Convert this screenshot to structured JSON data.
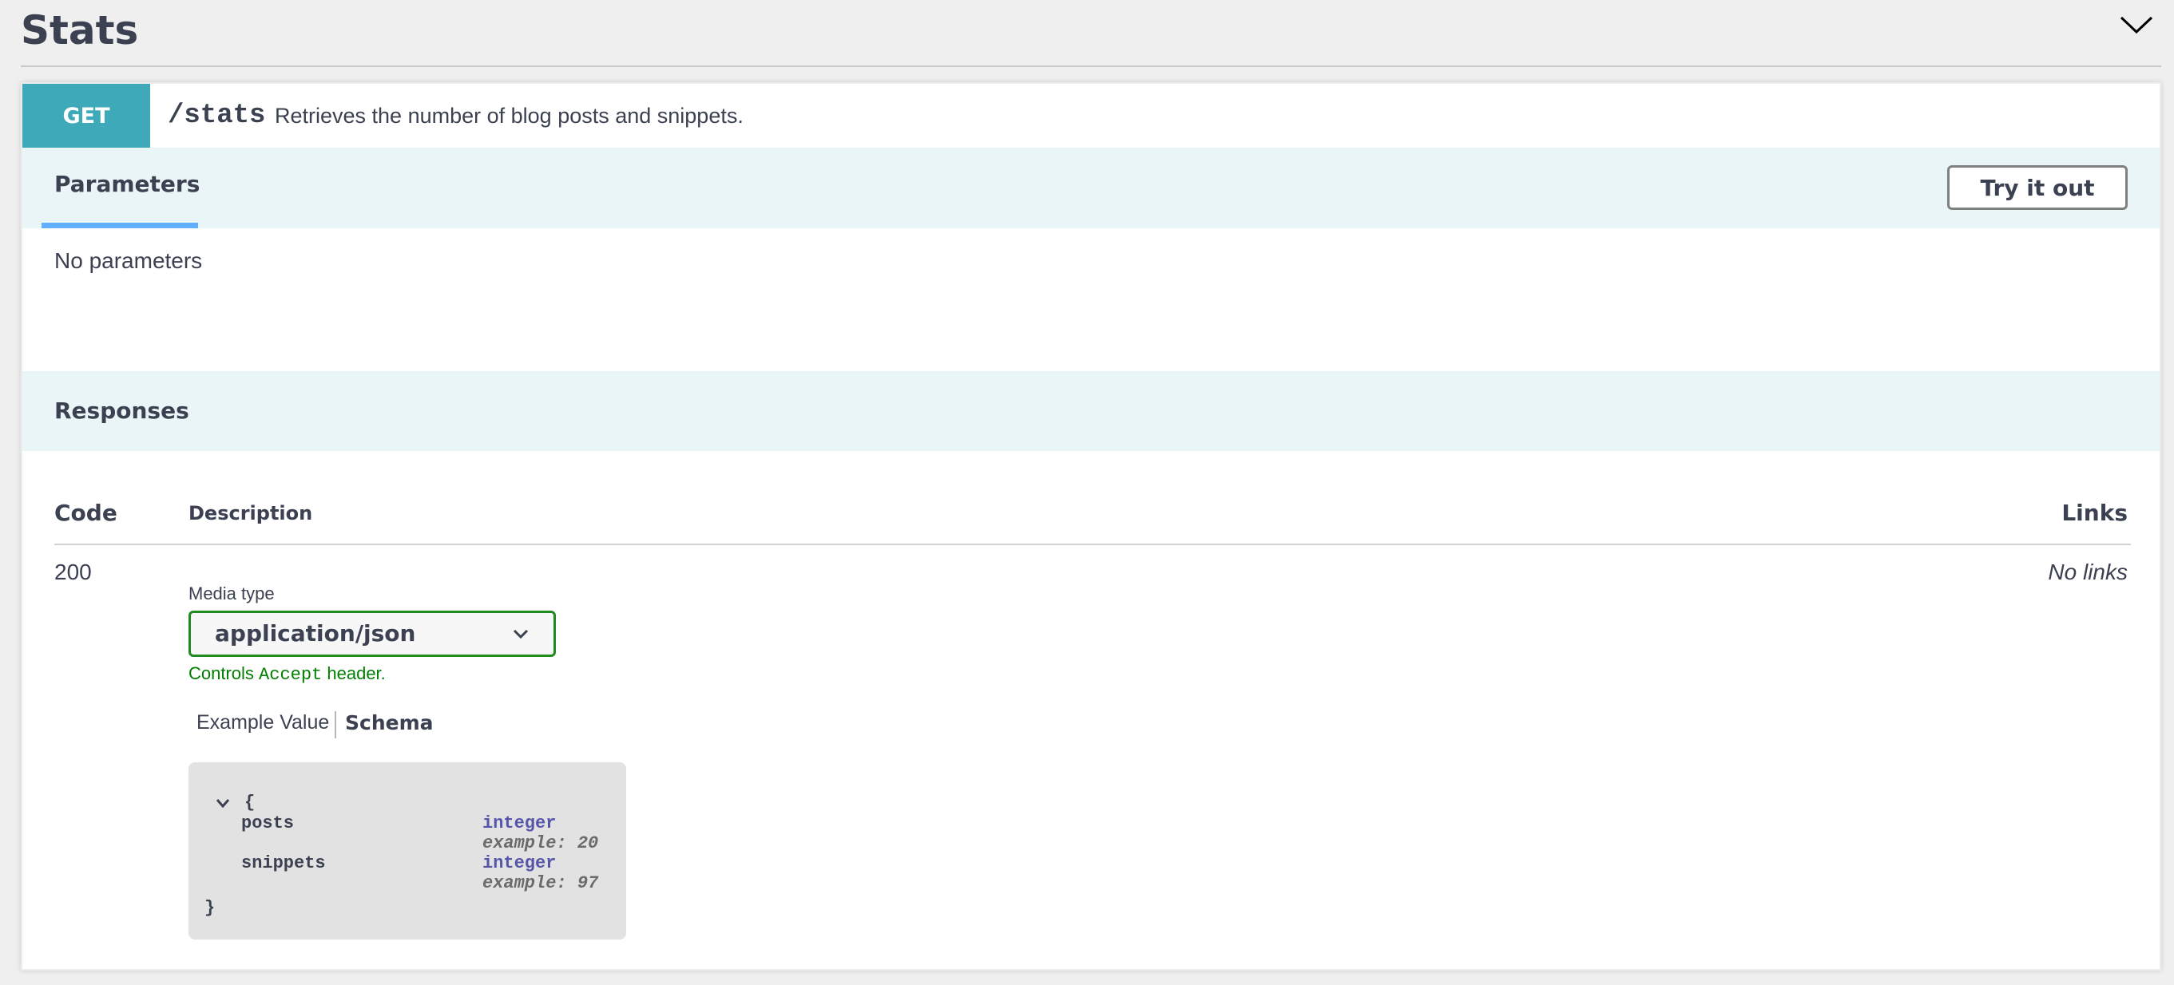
{
  "section": {
    "title": "Stats"
  },
  "operation": {
    "method": "GET",
    "path": "/stats",
    "description": "Retrieves the number of blog posts and snippets."
  },
  "parameters": {
    "tab_label": "Parameters",
    "try_button": "Try it out",
    "empty_text": "No parameters"
  },
  "responses": {
    "title": "Responses",
    "columns": {
      "code": "Code",
      "description": "Description",
      "links": "Links"
    },
    "rows": [
      {
        "code": "200",
        "links": "No links",
        "media_type_label": "Media type",
        "media_type_value": "application/json",
        "controls_prefix": "Controls ",
        "controls_code": "Accept",
        "controls_suffix": " header.",
        "tabs": [
          "Example Value",
          "Schema"
        ],
        "active_tab": "Schema",
        "schema": {
          "open": "{",
          "close": "}",
          "properties": [
            {
              "name": "posts",
              "type": "integer",
              "example": "example: 20"
            },
            {
              "name": "snippets",
              "type": "integer",
              "example": "example: 97"
            }
          ]
        }
      }
    ]
  },
  "colors": {
    "get_method": "#3ea9b8",
    "header_band": "#eaf5f7",
    "tab_underline": "#61affe",
    "select_border": "#1f8a1f",
    "controls_text": "#008000"
  }
}
